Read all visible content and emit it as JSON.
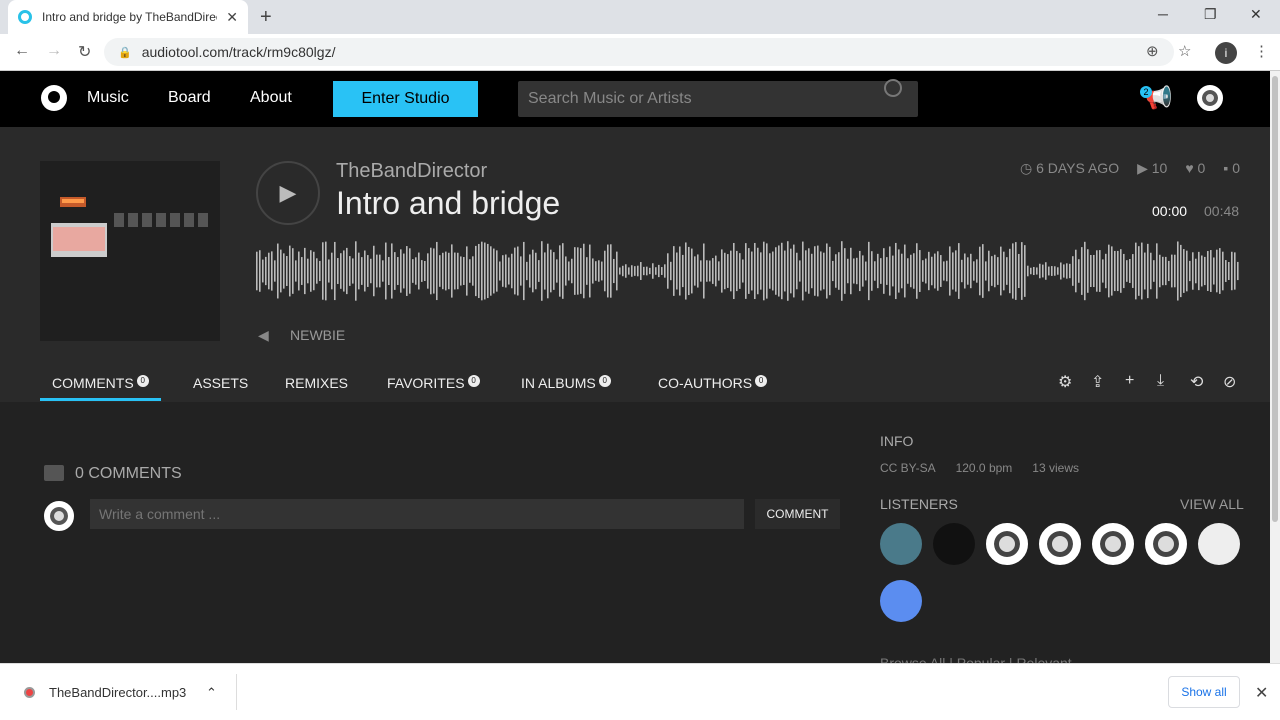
{
  "browser": {
    "tab_title": "Intro and bridge by TheBandDirector",
    "tab_close": "✕",
    "new_tab": "+",
    "window_controls": [
      "─",
      "❐",
      "✕"
    ],
    "back": "←",
    "forward": "→",
    "reload": "↻",
    "lock": "🔒",
    "url": "audiotool.com/track/rm9c80lgz/",
    "right_icons": [
      "⊕",
      "☆"
    ],
    "profile_initial": "i",
    "menu": "⋮"
  },
  "header": {
    "nav": [
      "Music",
      "Board",
      "About"
    ],
    "enter_studio": "Enter Studio",
    "search_placeholder": "Search Music or Artists",
    "notification_count": "2",
    "megaphone_icon": "📢"
  },
  "track": {
    "artist": "TheBandDirector",
    "title": "Intro and bridge",
    "play_icon": "▶",
    "posted": "6 DAYS AGO",
    "plays": "10",
    "favorites": "0",
    "comments": "0",
    "time_current": "00:00",
    "time_total": "00:48",
    "tag_icon": "◀",
    "tag": "NEWBIE"
  },
  "tabs": [
    {
      "label": "COMMENTS",
      "count": "0"
    },
    {
      "label": "ASSETS",
      "count": ""
    },
    {
      "label": "REMIXES",
      "count": ""
    },
    {
      "label": "FAVORITES",
      "count": "0"
    },
    {
      "label": "IN ALBUMS",
      "count": "0"
    },
    {
      "label": "CO-AUTHORS",
      "count": "0"
    }
  ],
  "actions": [
    "⚙",
    "⇪",
    "+",
    "⤓",
    "⟲",
    "⊘"
  ],
  "comments": {
    "title": "0 COMMENTS",
    "placeholder": "Write a comment ...",
    "button": "COMMENT"
  },
  "info": {
    "heading": "INFO",
    "license": "CC BY-SA",
    "bpm": "120.0 bpm",
    "views": "13 views",
    "listeners_heading": "LISTENERS",
    "view_all": "VIEW ALL",
    "browse": "Browse  All | Popular | Relevant"
  },
  "downloads": {
    "file": "TheBandDirector....mp3",
    "chevron": "⌃",
    "show_all": "Show all",
    "close": "✕"
  }
}
